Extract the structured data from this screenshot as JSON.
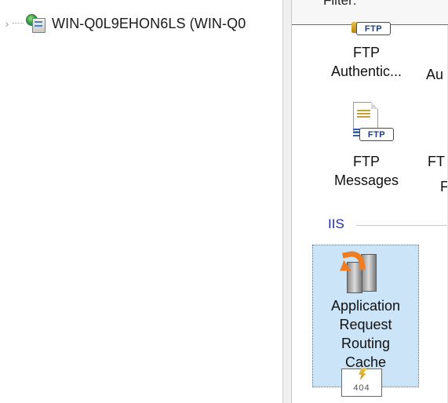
{
  "tree": {
    "expander_glyph": "›",
    "server_node_label": "WIN-Q0L9EHON6LS (WIN-Q0",
    "server_icon": "server-globe-icon"
  },
  "feature_pane": {
    "filter_label": "Filter:",
    "row1": [
      {
        "lines": [
          "FTP",
          "Authentic..."
        ],
        "icon": "ftp-authentication-icon",
        "badge": "FTP"
      },
      {
        "partial_text": "Au"
      }
    ],
    "row2": [
      {
        "lines": [
          "FTP",
          "Messages"
        ],
        "icon": "ftp-messages-icon",
        "badge": "FTP"
      },
      {
        "partial_lines": [
          "FT",
          "F"
        ]
      }
    ],
    "group_iis": {
      "label": "IIS"
    },
    "selected_feature": {
      "lines": [
        "Application",
        "Request",
        "Routing",
        "Cache"
      ],
      "icon": "application-request-routing-icon"
    },
    "next_icon": {
      "icon": "error-pages-404-icon",
      "text": "404"
    }
  },
  "colors": {
    "selection_bg": "#cce4f7",
    "selection_border": "#4a78b8",
    "group_header": "#1f2fa0",
    "arrow_orange": "#f07d22"
  }
}
